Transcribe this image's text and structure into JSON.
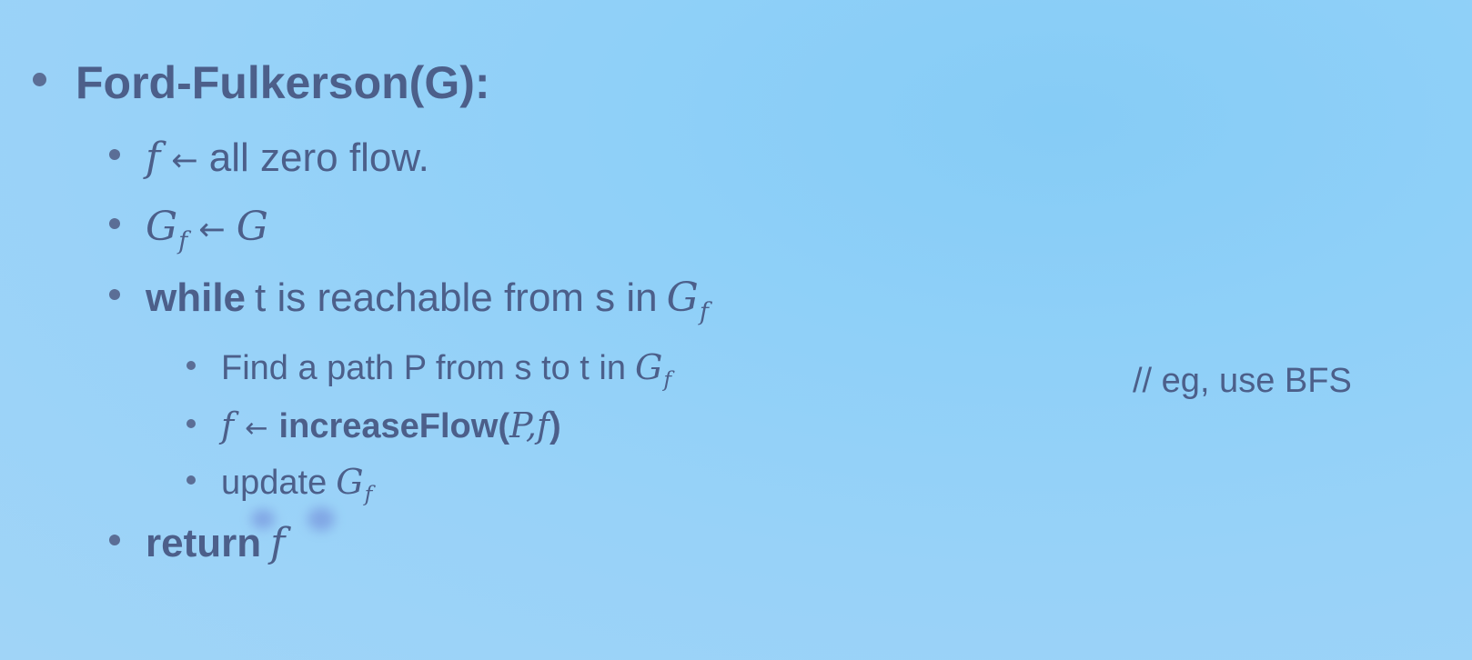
{
  "slide": {
    "title": "Ford-Fulkerson(G):",
    "lines": [
      {
        "var": "f",
        "arrow": "←",
        "text": "all zero flow."
      },
      {
        "var": "G",
        "sub": "f",
        "arrow": "←",
        "rhs": "G"
      },
      {
        "keyword": "while",
        "text": "t is reachable from s in",
        "var": "G",
        "sub": "f"
      }
    ],
    "loop_body": [
      {
        "text": "Find a path P from s to t in",
        "var": "G",
        "sub": "f"
      },
      {
        "var": "f",
        "arrow": "←",
        "call": "increaseFlow(",
        "args": "P,f",
        "close": ")"
      },
      {
        "text": "update",
        "var": "G",
        "sub": "f"
      }
    ],
    "comment": "// eg, use BFS",
    "return": {
      "keyword": "return",
      "var": "f"
    }
  },
  "colors": {
    "background": "#90d0f8",
    "text": "#4c5f8a",
    "smudge": "#6d84d6"
  }
}
